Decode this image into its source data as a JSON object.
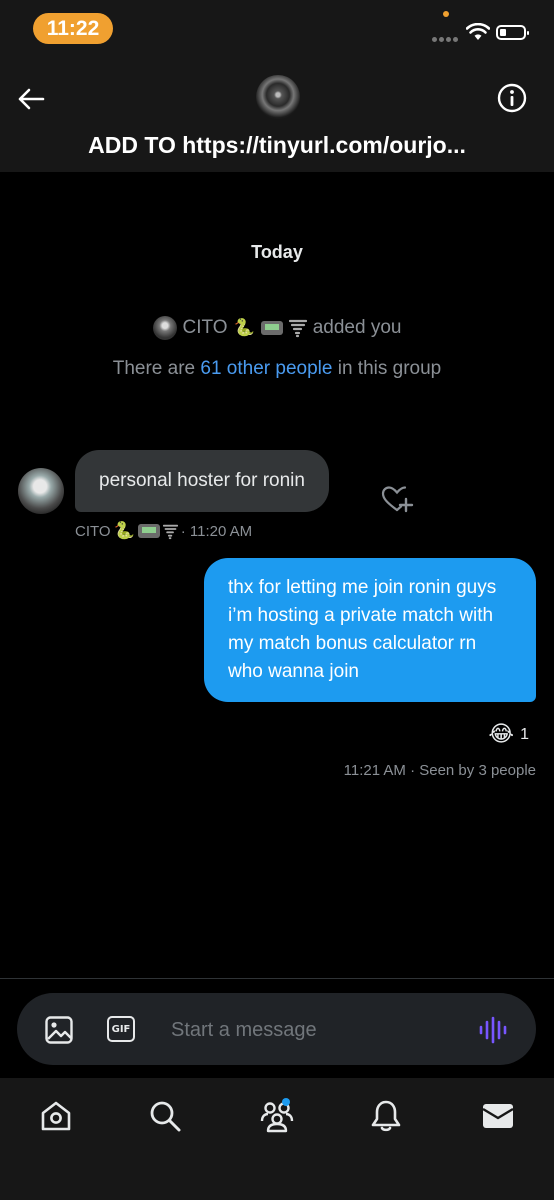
{
  "status_bar": {
    "time": "11:22"
  },
  "header": {
    "title": "ADD TO https://tinyurl.com/ourjo..."
  },
  "conversation": {
    "day_label": "Today",
    "system_added": {
      "name": "CITO",
      "emojis": "🐍",
      "action": "added you"
    },
    "system_count": {
      "prefix": "There are ",
      "link": "61 other people",
      "suffix": " in this group"
    },
    "messages": [
      {
        "direction": "incoming",
        "text": "personal hoster for ronin",
        "sender": "CITO",
        "sender_emoji": "🐍",
        "time": "· 11:20 AM"
      },
      {
        "direction": "outgoing",
        "text": "thx for letting me join ronin guys i’m hosting a private match with my match bonus calculator rn who wanna join",
        "reaction_emoji": "😂",
        "reaction_count": "1",
        "time": "11:21 AM",
        "seen": " · Seen by 3 people"
      }
    ]
  },
  "composer": {
    "gif_label": "GIF",
    "placeholder": "Start a message"
  },
  "nav": {
    "items": [
      "home-icon",
      "search-icon",
      "communities-icon",
      "notifications-icon",
      "messages-icon"
    ],
    "accent": "#1d9bf0"
  },
  "colors": {
    "outgoing_bubble": "#1d9bf0",
    "incoming_bubble": "#333638",
    "link": "#4a9bf0",
    "time_pill": "#f0a030",
    "voice_accent": "#7856ff"
  }
}
